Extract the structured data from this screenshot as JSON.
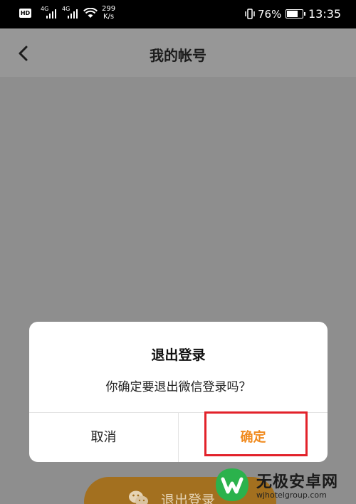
{
  "status_bar": {
    "hd_label": "HD",
    "net1_label": "4G",
    "net2_label": "4G",
    "speed_value": "299",
    "speed_unit": "K/s",
    "battery_percent": "76%",
    "battery_level": 0.76,
    "time": "13:35"
  },
  "nav": {
    "title": "我的帐号"
  },
  "background": {
    "logout_button_label": "退出登录"
  },
  "dialog": {
    "title": "退出登录",
    "message": "你确定要退出微信登录吗？",
    "cancel_label": "取消",
    "confirm_label": "确定"
  },
  "watermark": {
    "brand": "无极安卓网",
    "url": "wjhotelgroup.com"
  },
  "colors": {
    "accent": "#f08a1e",
    "highlight": "#e2222a",
    "watermark_green": "#2bb24c"
  }
}
